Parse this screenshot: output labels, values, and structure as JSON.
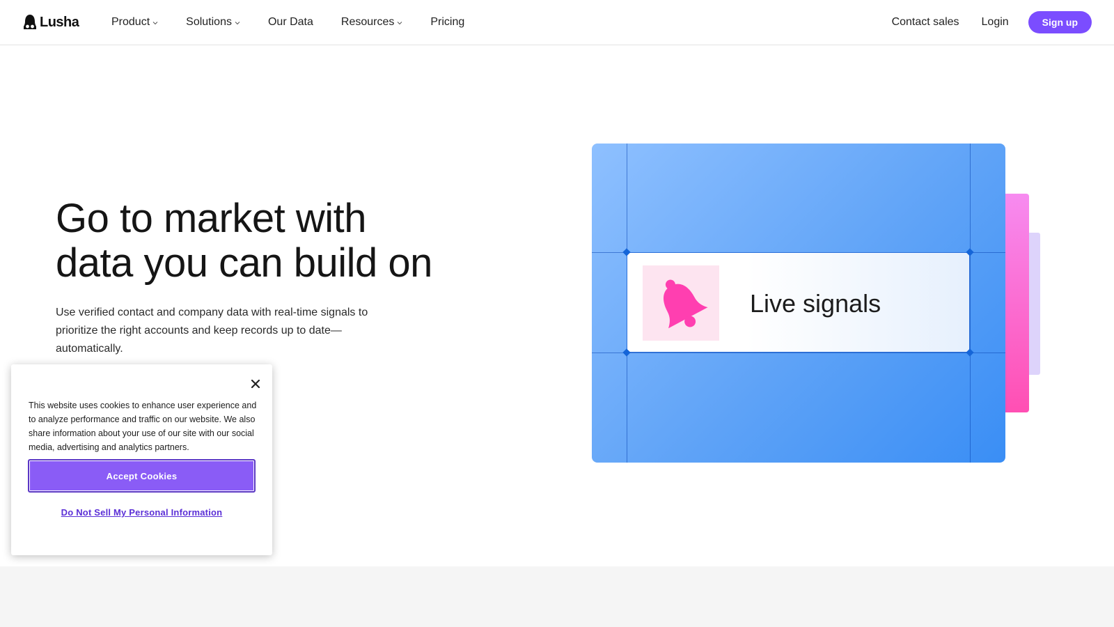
{
  "header": {
    "logo_text": "Lusha",
    "nav": [
      {
        "label": "Product",
        "has_dropdown": true
      },
      {
        "label": "Solutions",
        "has_dropdown": true
      },
      {
        "label": "Our Data",
        "has_dropdown": false
      },
      {
        "label": "Resources",
        "has_dropdown": true
      },
      {
        "label": "Pricing",
        "has_dropdown": false
      }
    ],
    "contact_sales": "Contact sales",
    "login": "Login",
    "signup": "Sign up"
  },
  "hero": {
    "title_line1": "Go to market with",
    "title_line2": "data you can build on",
    "subtitle": "Use verified contact and company data with real-time signals to prioritize the right accounts and keep records up to date—automatically."
  },
  "illustration": {
    "card_label": "Live signals",
    "icon": "bell-icon"
  },
  "cookie_banner": {
    "text": "This website uses cookies to enhance user experience and to analyze performance and traffic on our website. We also share information about your use of our site with our social media, advertising and analytics partners.",
    "accept_label": "Accept Cookies",
    "do_not_sell_label": "Do Not Sell My Personal Information",
    "close_icon": "close-icon"
  },
  "colors": {
    "accent": "#7b4dff",
    "accept_button": "#8a5cf6",
    "panel_blue": "#5fa3f7",
    "panel_pink": "#ff4fb3",
    "bell_pink": "#ff3fb0"
  }
}
